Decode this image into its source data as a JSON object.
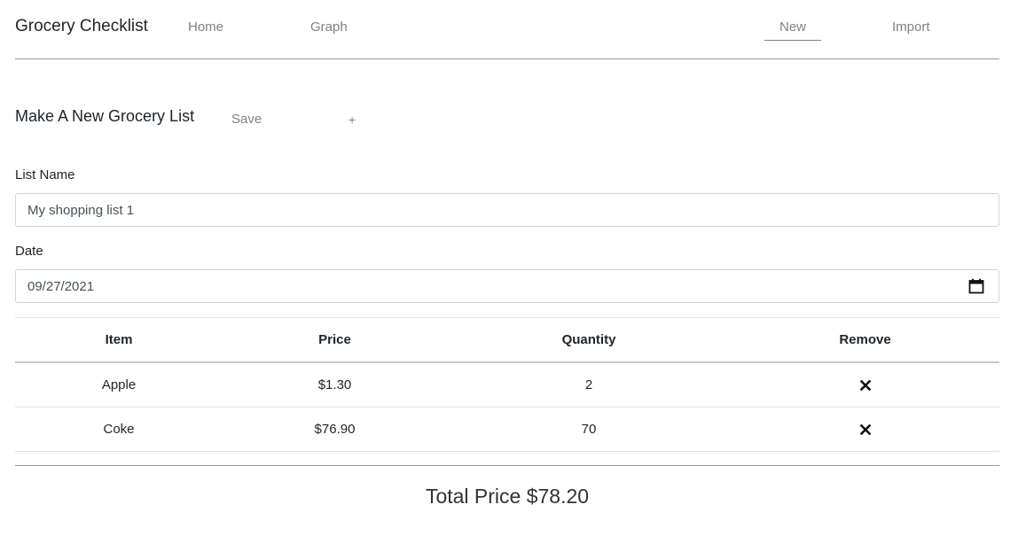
{
  "nav": {
    "brand": "Grocery Checklist",
    "links": {
      "home": "Home",
      "graph": "Graph",
      "new": "New",
      "import": "Import"
    },
    "active": "New"
  },
  "section": {
    "title": "Make A New Grocery List",
    "save_label": "Save",
    "add_label": "+"
  },
  "form": {
    "name_label": "List Name",
    "name_value": "My shopping list 1",
    "date_label": "Date",
    "date_value": "09/27/2021"
  },
  "table": {
    "columns": [
      "Item",
      "Price",
      "Quantity",
      "Remove"
    ],
    "rows": [
      {
        "item": "Apple",
        "price": "$1.30",
        "quantity": "2"
      },
      {
        "item": "Coke",
        "price": "$76.90",
        "quantity": "70"
      }
    ],
    "remove_icon": "close-icon"
  },
  "total": {
    "text": "Total Price $78.20"
  },
  "colors": {
    "text": "#212529",
    "muted": "#808080",
    "border": "#ced4da"
  }
}
